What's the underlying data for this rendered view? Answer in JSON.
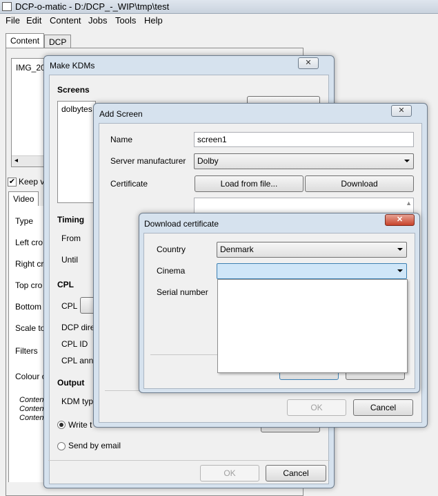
{
  "app": {
    "title": "DCP-o-matic - D:/DCP_-_WIP\\tmp\\test",
    "menu": [
      "File",
      "Edit",
      "Content",
      "Jobs",
      "Tools",
      "Help"
    ]
  },
  "main": {
    "tabs": [
      "Content",
      "DCP"
    ],
    "content_item": "IMG_20",
    "keep_label": "Keep vi",
    "sub_tabs": [
      "Video"
    ],
    "video_labels": [
      "Type",
      "Left cro",
      "Right cr",
      "Top cro",
      "Bottom",
      "Scale to",
      "Filters",
      "Colour c"
    ],
    "content_lines": [
      "Conten",
      "Conten",
      "Conten"
    ]
  },
  "make_kdms": {
    "title": "Make KDMs",
    "screens_heading": "Screens",
    "screens_item": "dolbytes",
    "timing_heading": "Timing",
    "from_label": "From",
    "until_label": "Until",
    "cpl_heading": "CPL",
    "cpl_label": "CPL",
    "dcp_dir_label": "DCP dire",
    "cpl_id_label": "CPL ID",
    "cpl_ann_label": "CPL ann",
    "output_heading": "Output",
    "kdm_type_label": "KDM typ",
    "write_label": "Write t",
    "email_label": "Send by email",
    "ok": "OK",
    "cancel": "Cancel"
  },
  "add_screen": {
    "title": "Add Screen",
    "name_label": "Name",
    "name_value": "screen1",
    "manufacturer_label": "Server manufacturer",
    "manufacturer_value": "Dolby",
    "certificate_label": "Certificate",
    "load_button": "Load from file...",
    "download_button": "Download",
    "ok": "OK",
    "cancel": "Cancel"
  },
  "download_cert": {
    "title": "Download certificate",
    "country_label": "Country",
    "country_value": "Denmark",
    "cinema_label": "Cinema",
    "cinema_value": "",
    "serial_label": "Serial number"
  },
  "icons": {
    "close": "close-icon",
    "dropdown": "chevron-down-icon"
  },
  "colors": {
    "accent": "#3c7fb1",
    "close_red": "#c7432b"
  }
}
